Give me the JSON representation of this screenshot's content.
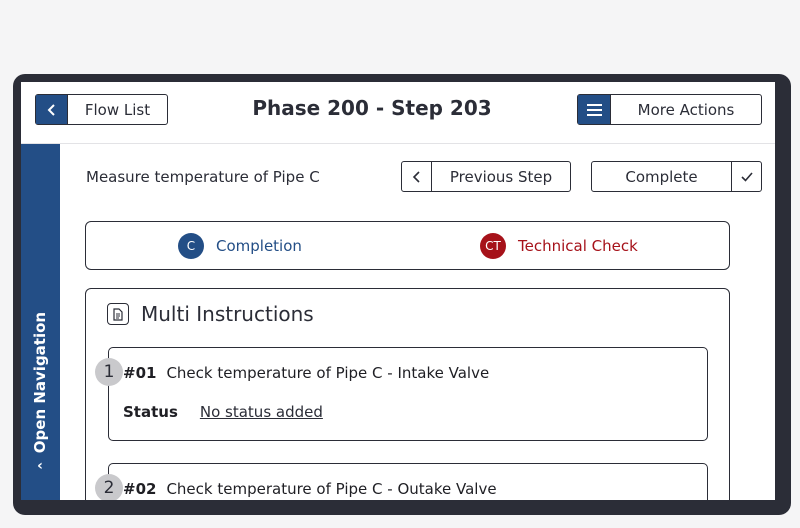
{
  "header": {
    "back_label": "Flow List",
    "title": "Phase 200 - Step 203",
    "more_actions_label": "More Actions"
  },
  "sidebar": {
    "open_navigation_label": "Open Navigation"
  },
  "step": {
    "description": "Measure temperature of Pipe C",
    "previous_label": "Previous Step",
    "complete_label": "Complete"
  },
  "tabs": [
    {
      "badge": "C",
      "label": "Completion",
      "color": "#234e86"
    },
    {
      "badge": "CT",
      "label": "Technical Check",
      "color": "#a6121a"
    }
  ],
  "multi": {
    "title": "Multi Instructions",
    "items": [
      {
        "index": "1",
        "number": "#01",
        "text": "Check temperature of Pipe C - Intake Valve",
        "status_label": "Status",
        "status_value": "No status added"
      },
      {
        "index": "2",
        "number": "#02",
        "text": "Check temperature of Pipe C - Outake Valve"
      }
    ]
  },
  "colors": {
    "primary": "#234e86",
    "danger": "#a6121a",
    "frame": "#2b2d37"
  }
}
